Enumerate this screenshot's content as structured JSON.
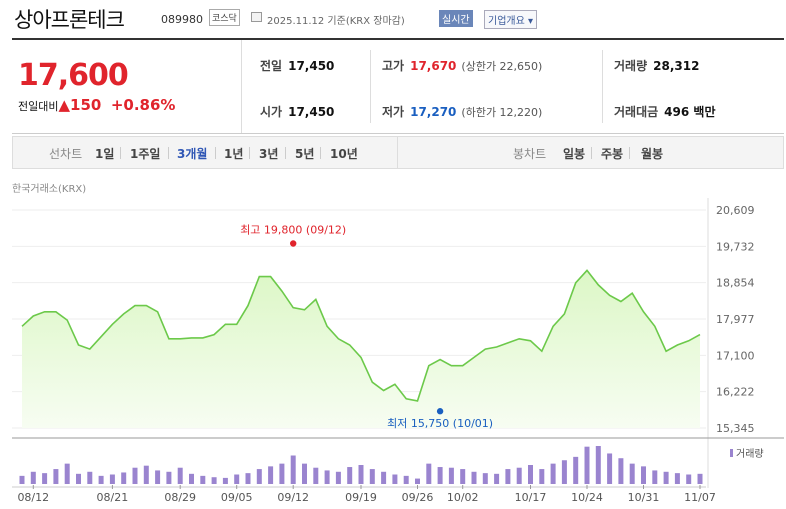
{
  "stock": {
    "name": "상아프론테크",
    "code": "089980",
    "market": "코스닥",
    "date_text": "2025.11.12  기준(KRX 장마감)",
    "realtime_label": "실시간",
    "company_info_label": "기업개요 ▾",
    "price": "17,600",
    "change_label": "전일대비",
    "change_value": "▲150",
    "change_pct": "+0.86%",
    "stats": {
      "prev_close": {
        "label": "전일",
        "value": "17,450"
      },
      "high": {
        "label": "고가",
        "value": "17,670",
        "sub": "(상한가 22,650)"
      },
      "volume": {
        "label": "거래량",
        "value": "28,312"
      },
      "open": {
        "label": "시가",
        "value": "17,450"
      },
      "low": {
        "label": "저가",
        "value": "17,270",
        "sub": "(하한가 12,220)"
      },
      "amount": {
        "label": "거래대금",
        "value": "496 백만"
      }
    }
  },
  "colors": {
    "up": "#e0242c",
    "down": "#1a5fc0",
    "area": "#dcf7c6",
    "line": "#6cc94a",
    "volume": "#9a84cf"
  },
  "tabs": {
    "line_title": "선차트",
    "line_items": [
      "1일",
      "1주일",
      "3개월",
      "1년",
      "3년",
      "5년",
      "10년"
    ],
    "selected": "3개월",
    "candle_title": "봉차트",
    "candle_items": [
      "일봉",
      "주봉",
      "월봉"
    ]
  },
  "source_label": "한국거래소(KRX)",
  "volume_legend": "거래량",
  "chart_data": {
    "type": "area",
    "ylim": [
      15345,
      20609
    ],
    "yticks": [
      "20,609",
      "19,732",
      "18,854",
      "17,977",
      "17,100",
      "16,222",
      "15,345"
    ],
    "ytick_values": [
      20609,
      19732,
      18854,
      17977,
      17100,
      16222,
      15345
    ],
    "xticks": [
      "08/12",
      "08/21",
      "08/29",
      "09/05",
      "09/12",
      "09/19",
      "09/26",
      "10/02",
      "10/17",
      "10/24",
      "10/31",
      "11/07"
    ],
    "xtick_index": [
      1,
      8,
      14,
      19,
      24,
      30,
      35,
      39,
      45,
      50,
      55,
      60
    ],
    "max_label": "최고 19,800 (09/12)",
    "max_index": 24,
    "max_value": 19800,
    "min_label": "최저 15,750 (10/01)",
    "min_index": 37,
    "min_value": 15750,
    "prices": [
      17800,
      18050,
      18150,
      18150,
      17950,
      17350,
      17250,
      17550,
      17850,
      18100,
      18300,
      18300,
      18150,
      17500,
      17500,
      17520,
      17520,
      17600,
      17850,
      17850,
      18300,
      19000,
      19000,
      18650,
      18250,
      18200,
      18450,
      17800,
      17500,
      17350,
      17050,
      16450,
      16250,
      16400,
      16050,
      16000,
      16850,
      17000,
      16850,
      16850,
      17050,
      17250,
      17300,
      17400,
      17500,
      17450,
      17200,
      17800,
      18100,
      18850,
      19150,
      18800,
      18550,
      18400,
      18600,
      18150,
      17800,
      17200,
      17350,
      17450,
      17600
    ],
    "volumes": [
      12,
      18,
      16,
      22,
      30,
      15,
      18,
      12,
      14,
      17,
      24,
      27,
      20,
      18,
      24,
      15,
      12,
      10,
      9,
      14,
      16,
      22,
      26,
      30,
      42,
      30,
      24,
      20,
      18,
      25,
      28,
      22,
      18,
      14,
      12,
      8,
      30,
      25,
      24,
      22,
      18,
      16,
      15,
      22,
      24,
      28,
      22,
      30,
      35,
      40,
      55,
      56,
      45,
      38,
      30,
      26,
      20,
      18,
      16,
      14,
      15
    ]
  }
}
